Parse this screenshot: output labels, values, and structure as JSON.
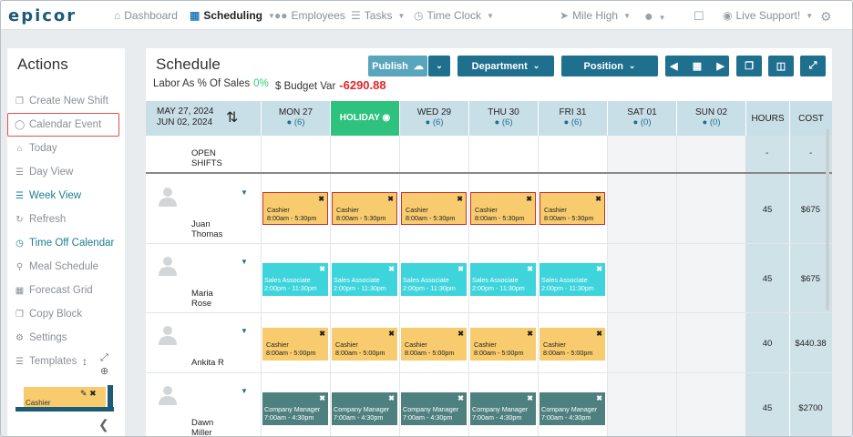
{
  "nav": {
    "logo": "epicor",
    "items": [
      {
        "label": "Dashboard",
        "icon": "home-icon"
      },
      {
        "label": "Scheduling",
        "icon": "calendar-icon",
        "active": true
      },
      {
        "label": "Employees",
        "icon": "users-icon"
      },
      {
        "label": "Tasks",
        "icon": "tasks-icon"
      },
      {
        "label": "Time Clock",
        "icon": "clock-icon"
      },
      {
        "label": "Mile High",
        "icon": "location-arrow-icon"
      },
      {
        "label": "",
        "icon": "user-avatar-icon"
      },
      {
        "label": "",
        "icon": "chat-icon"
      },
      {
        "label": "Live Support!",
        "icon": "globe-icon"
      },
      {
        "label": "",
        "icon": "gear-icon"
      }
    ]
  },
  "sidebar": {
    "title": "Actions",
    "items": [
      {
        "label": "Create New Shift",
        "icon": "copy-icon"
      },
      {
        "label": "Calendar Event",
        "icon": "comment-icon",
        "highlighted": true
      },
      {
        "label": "Today",
        "icon": "home-icon"
      },
      {
        "label": "Day View",
        "icon": "list-icon"
      },
      {
        "label": "Week View",
        "icon": "list-icon",
        "active": true
      },
      {
        "label": "Refresh",
        "icon": "refresh-icon"
      },
      {
        "label": "Time Off Calendar",
        "icon": "clock-icon",
        "active": true
      },
      {
        "label": "Meal Schedule",
        "icon": "utensils-icon"
      },
      {
        "label": "Forecast Grid",
        "icon": "grid-icon"
      },
      {
        "label": "Copy Block",
        "icon": "copy-icon"
      },
      {
        "label": "Settings",
        "icon": "gears-icon"
      },
      {
        "label": "Templates",
        "icon": "list-icon"
      }
    ],
    "template_card_label": "Cashier"
  },
  "schedule": {
    "title": "Schedule",
    "labor_label": "Labor As % Of Sales",
    "labor_value": "0%",
    "budget_label": "$ Budget Var",
    "budget_value": "-6290.88",
    "publish_label": "Publish",
    "department_label": "Department",
    "position_label": "Position",
    "accent": "#1f6f8f",
    "date_range_start": "MAY 27, 2024",
    "date_range_end": "JUN 02, 2024",
    "days": [
      {
        "label": "MON 27",
        "count": "(6)"
      },
      {
        "label": "HOLIDAY",
        "count": "",
        "holiday": true
      },
      {
        "label": "WED 29",
        "count": "(6)"
      },
      {
        "label": "THU 30",
        "count": "(6)"
      },
      {
        "label": "FRI 31",
        "count": "(6)"
      },
      {
        "label": "SAT 01",
        "count": "(0)"
      },
      {
        "label": "SUN 02",
        "count": "(0)"
      }
    ],
    "hours_header": "HOURS",
    "cost_header": "COST",
    "open_shifts_label_1": "OPEN",
    "open_shifts_label_2": "SHIFTS",
    "open_hours": "-",
    "open_cost": "-",
    "employees": [
      {
        "first": "Juan",
        "last": "Thomas",
        "hours": "45",
        "cost": "$675",
        "shift_type": "cashier",
        "shift_title": "Cashier",
        "shift_time": "8:00am - 5:30pm",
        "red": true
      },
      {
        "first": "Maria",
        "last": "Rose",
        "hours": "45",
        "cost": "$675",
        "shift_type": "sales",
        "shift_title": "Sales Associate",
        "shift_time": "2:00pm - 11:30pm",
        "red": false
      },
      {
        "first": "Ankita R",
        "last": "",
        "hours": "40",
        "cost": "$440.38",
        "shift_type": "cashier",
        "shift_title": "Cashier",
        "shift_time": "8:00am - 5:00pm",
        "red": false
      },
      {
        "first": "Dawn",
        "last": "Miller",
        "hours": "45",
        "cost": "$2700",
        "shift_type": "mgr",
        "shift_title": "Company Manager",
        "shift_time": "7:00am - 4:30pm",
        "red": false
      }
    ]
  }
}
